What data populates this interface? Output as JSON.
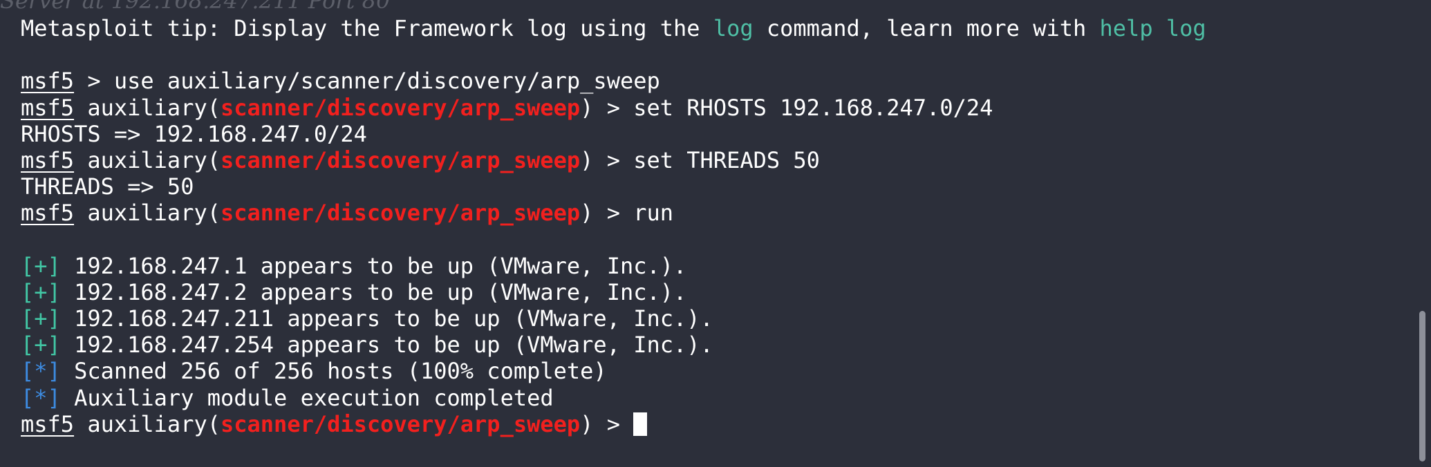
{
  "background_text": "Server at 192.168.247.211 Port 80",
  "colors": {
    "background": "#2c2f3a",
    "text": "#ffffff",
    "module": "#f2201e",
    "tip_command": "#4fbfa5",
    "good_marker": "#42c7a5",
    "info_marker": "#3d8be0"
  },
  "tip": {
    "prefix": "Metasploit tip: Display the Framework log using the ",
    "cmd1": "log",
    "middle": " command, learn more with ",
    "cmd2": "help log"
  },
  "prompt": {
    "name": "msf5",
    "module_prefix": " auxiliary(",
    "module": "scanner/discovery/arp_sweep",
    "module_suffix": ") > "
  },
  "commands": {
    "use": " > use auxiliary/scanner/discovery/arp_sweep",
    "set_rhosts": "set RHOSTS 192.168.247.0/24",
    "set_threads": "set THREADS 50",
    "run": "run"
  },
  "outputs": {
    "rhosts": "RHOSTS => 192.168.247.0/24",
    "threads": "THREADS => 50"
  },
  "markers": {
    "good": "[+]",
    "info": "[*]"
  },
  "results": {
    "host1": " 192.168.247.1 appears to be up (VMware, Inc.).",
    "host2": " 192.168.247.2 appears to be up (VMware, Inc.).",
    "host3": " 192.168.247.211 appears to be up (VMware, Inc.).",
    "host4": " 192.168.247.254 appears to be up (VMware, Inc.).",
    "scanned": " Scanned 256 of 256 hosts (100% complete)",
    "completed": " Auxiliary module execution completed"
  }
}
